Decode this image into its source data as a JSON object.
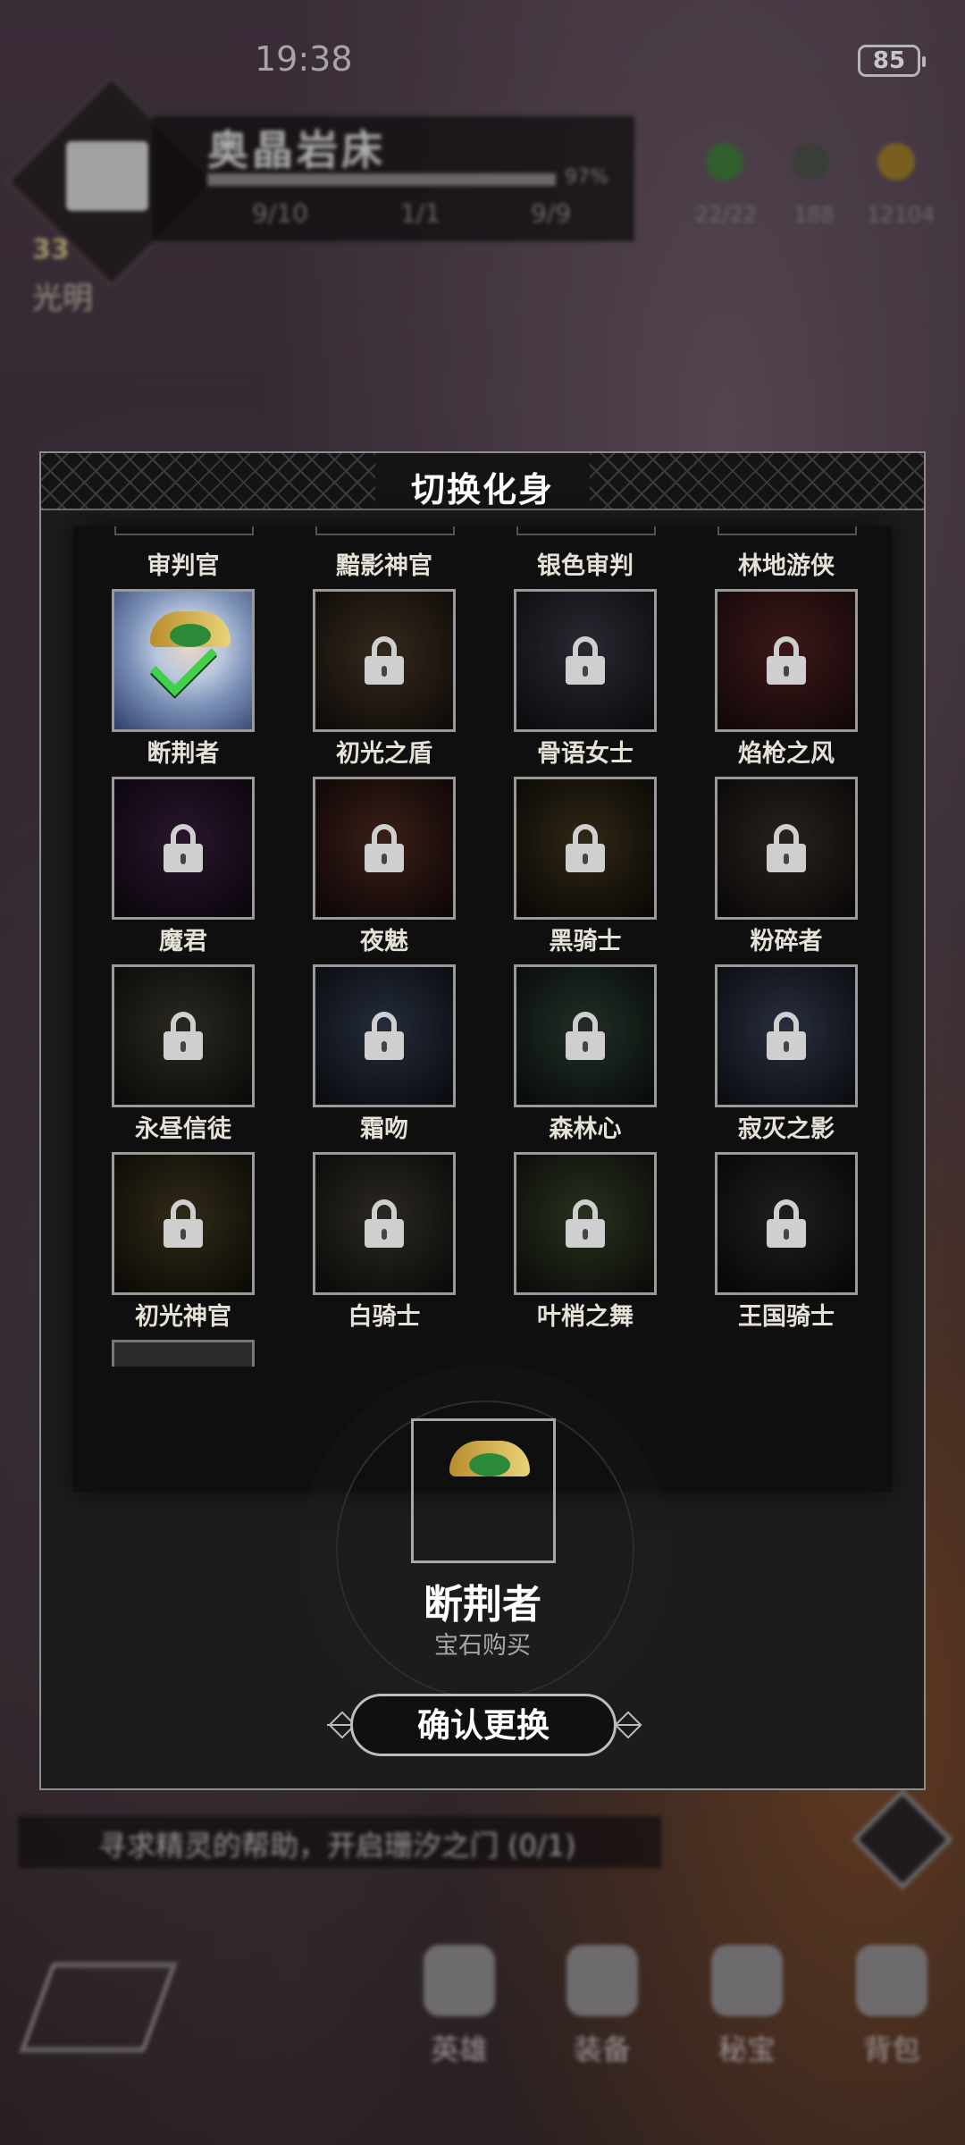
{
  "status_bar": {
    "time": "19:38",
    "battery": "85"
  },
  "hud": {
    "location_title": "奥晶岩床",
    "progress_text": "97%",
    "level_label": "光明",
    "level_value": "33",
    "stats": [
      "9/10",
      "1/1",
      "9/9"
    ],
    "resources": [
      "22/22",
      "188",
      "12104"
    ],
    "quest": "寻求精灵的帮助，开启珊汐之门 (0/1)",
    "nav": [
      "英雄",
      "装备",
      "秘宝",
      "背包"
    ]
  },
  "modal": {
    "title": "切换化身",
    "top_labels": [
      "审判官",
      "黯影神官",
      "银色审判",
      "林地游侠"
    ],
    "avatars": [
      {
        "name": "断荆者",
        "locked": false,
        "selected": true
      },
      {
        "name": "初光之盾",
        "locked": true
      },
      {
        "name": "骨语女士",
        "locked": true
      },
      {
        "name": "焰枪之风",
        "locked": true
      },
      {
        "name": "魔君",
        "locked": true
      },
      {
        "name": "夜魅",
        "locked": true
      },
      {
        "name": "黑骑士",
        "locked": true
      },
      {
        "name": "粉碎者",
        "locked": true
      },
      {
        "name": "永昼信徒",
        "locked": true
      },
      {
        "name": "霜吻",
        "locked": true
      },
      {
        "name": "森林心",
        "locked": true
      },
      {
        "name": "寂灭之影",
        "locked": true
      },
      {
        "name": "初光神官",
        "locked": true
      },
      {
        "name": "白骑士",
        "locked": true
      },
      {
        "name": "叶梢之舞",
        "locked": true
      },
      {
        "name": "王国骑士",
        "locked": true
      }
    ],
    "selected": {
      "name": "断荆者",
      "source": "宝石购买"
    },
    "confirm_label": "确认更换"
  },
  "colors": {
    "check": "#3fd14a",
    "panel": "#1c1c1c",
    "border": "#8d8d8d"
  }
}
